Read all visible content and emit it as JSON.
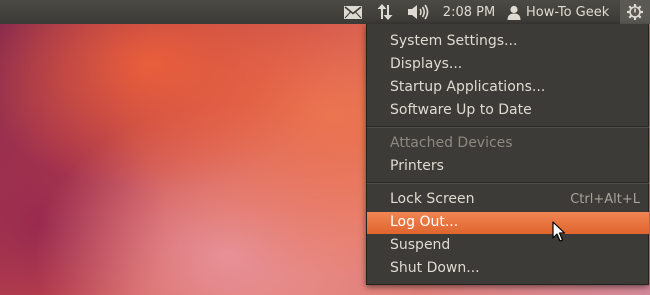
{
  "panel": {
    "clock": "2:08 PM",
    "user_name": "How-To Geek",
    "icons": [
      "mail-icon",
      "network-icon",
      "volume-icon",
      "user-icon",
      "power-gear-icon"
    ]
  },
  "session_menu": {
    "items": [
      {
        "label": "System Settings..."
      },
      {
        "label": "Displays..."
      },
      {
        "label": "Startup Applications..."
      },
      {
        "label": "Software Up to Date"
      },
      {
        "label": "Attached Devices",
        "enabled": false
      },
      {
        "label": "Printers"
      },
      {
        "label": "Lock Screen",
        "accelerator": "Ctrl+Alt+L"
      },
      {
        "label": "Log Out...",
        "highlighted": true
      },
      {
        "label": "Suspend"
      },
      {
        "label": "Shut Down..."
      }
    ]
  },
  "colors": {
    "panel_bg": "#3c3b37",
    "menu_bg": "#3c3b37",
    "highlight": "#e9703b",
    "text": "#dfdbd2",
    "disabled_text": "#8c8981"
  }
}
